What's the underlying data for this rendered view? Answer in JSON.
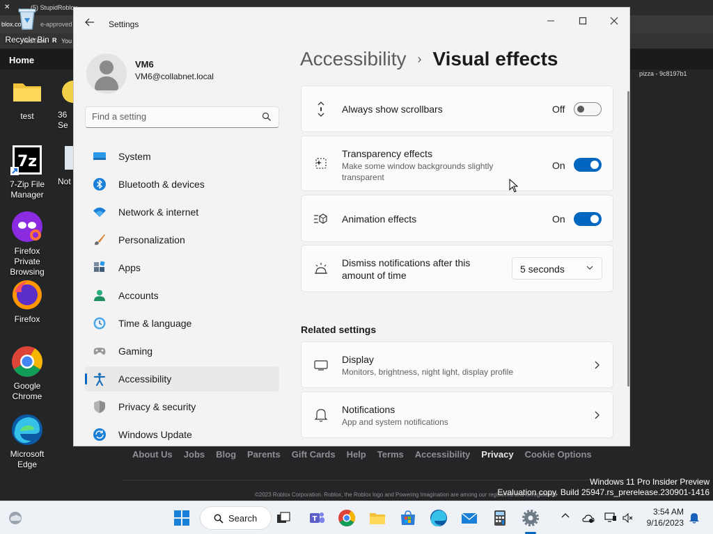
{
  "background": {
    "tab_text": "(5) StupidRoblox...",
    "addr_text": "blox.co",
    "approved_text": "e-approved",
    "youtube": "YouTube",
    "bookmark_r": "R",
    "bookmark_you": "You",
    "home_label": "Home",
    "pizza_text": "pizza - 9c8197b1",
    "footer_links": [
      "About Us",
      "Jobs",
      "Blog",
      "Parents",
      "Gift Cards",
      "Help",
      "Terms",
      "Accessibility",
      "Privacy",
      "Cookie Options"
    ],
    "copyright": "©2023 Roblox Corporation. Roblox, the Roblox logo and Powering Imagination are among our registered and unregistered"
  },
  "watermark": {
    "line1": "Windows 11 Pro Insider Preview",
    "line2": "Evaluation copy. Build 25947.rs_prerelease.230901-1416"
  },
  "desktop_icons": [
    {
      "label": "Recycle Bin",
      "icon": "recycle-bin-icon"
    },
    {
      "label": "test",
      "icon": "folder-icon"
    },
    {
      "label": "7-Zip File Manager",
      "icon": "7zip-icon"
    },
    {
      "label": "Firefox Private Browsing",
      "icon": "firefox-private-icon"
    },
    {
      "label": "Firefox",
      "icon": "firefox-icon"
    },
    {
      "label": "Google Chrome",
      "icon": "chrome-icon"
    },
    {
      "label": "Microsoft Edge",
      "icon": "edge-icon"
    }
  ],
  "partial_icons": {
    "p1": "36",
    "p2": "Se",
    "p3": "Not"
  },
  "window": {
    "title": "Settings",
    "back_icon": "back-arrow-icon",
    "minimize": "—",
    "maximize": "☐",
    "close": "✕"
  },
  "profile": {
    "name": "VM6",
    "email": "VM6@collabnet.local"
  },
  "search": {
    "placeholder": "Find a setting"
  },
  "nav": [
    {
      "label": "System",
      "icon": "system-icon",
      "active": false
    },
    {
      "label": "Bluetooth & devices",
      "icon": "bluetooth-icon",
      "active": false
    },
    {
      "label": "Network & internet",
      "icon": "wifi-icon",
      "active": false
    },
    {
      "label": "Personalization",
      "icon": "brush-icon",
      "active": false
    },
    {
      "label": "Apps",
      "icon": "apps-icon",
      "active": false
    },
    {
      "label": "Accounts",
      "icon": "accounts-icon",
      "active": false
    },
    {
      "label": "Time & language",
      "icon": "time-icon",
      "active": false
    },
    {
      "label": "Gaming",
      "icon": "gaming-icon",
      "active": false
    },
    {
      "label": "Accessibility",
      "icon": "accessibility-icon",
      "active": true
    },
    {
      "label": "Privacy & security",
      "icon": "shield-icon",
      "active": false
    },
    {
      "label": "Windows Update",
      "icon": "update-icon",
      "active": false
    }
  ],
  "breadcrumb": {
    "parent": "Accessibility",
    "separator": "›",
    "current": "Visual effects"
  },
  "settings": {
    "scrollbars": {
      "title": "Always show scrollbars",
      "state": "Off",
      "on": false
    },
    "transparency": {
      "title": "Transparency effects",
      "desc": "Make some window backgrounds slightly transparent",
      "state": "On",
      "on": true
    },
    "animation": {
      "title": "Animation effects",
      "state": "On",
      "on": true
    },
    "dismiss": {
      "title": "Dismiss notifications after this amount of time",
      "value": "5 seconds"
    }
  },
  "related": {
    "title": "Related settings",
    "display": {
      "title": "Display",
      "desc": "Monitors, brightness, night light, display profile"
    },
    "notifications": {
      "title": "Notifications",
      "desc": "App and system notifications"
    }
  },
  "taskbar": {
    "search_label": "Search",
    "time": "3:54 AM",
    "date": "9/16/2023",
    "apps": [
      "start-icon",
      "search",
      "task-view-icon",
      "teams-icon",
      "chrome-icon",
      "file-explorer-icon",
      "store-icon",
      "edge-icon",
      "mail-icon",
      "calculator-icon",
      "settings-icon"
    ]
  },
  "colors": {
    "accent": "#0067c0",
    "window_bg": "#f3f3f3",
    "card_bg": "#fbfbfb",
    "taskbar_bg": "#eef2f7"
  }
}
